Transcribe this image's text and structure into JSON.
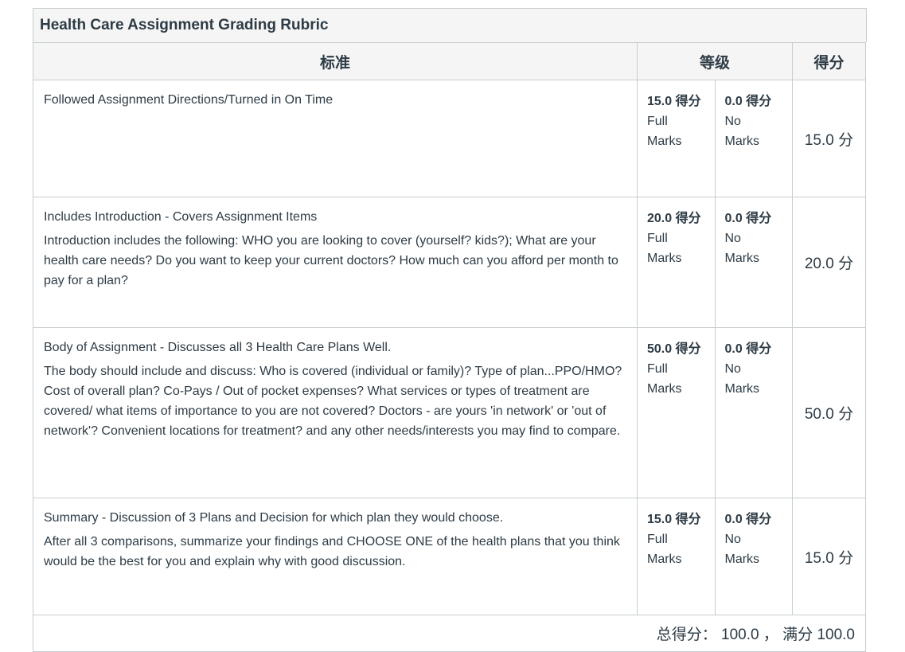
{
  "rubric": {
    "title": "Health Care Assignment Grading Rubric",
    "headers": {
      "criteria": "标准",
      "ratings": "等级",
      "points": "得分"
    },
    "criteria": [
      {
        "description": "Followed Assignment Directions/Turned in On Time",
        "long_description": "",
        "ratings": [
          {
            "points": "15.0 得分",
            "label_line1": "Full",
            "label_line2": "Marks"
          },
          {
            "points": "0.0 得分",
            "label_line1": "No",
            "label_line2": "Marks"
          }
        ],
        "score": "15.0 分"
      },
      {
        "description": "Includes Introduction - Covers Assignment Items",
        "long_description": "Introduction includes the following: WHO you are looking to cover (yourself? kids?); What are your health care needs? Do you want to keep your current doctors? How much can you afford per month to pay for a plan?",
        "ratings": [
          {
            "points": "20.0 得分",
            "label_line1": "Full",
            "label_line2": "Marks"
          },
          {
            "points": "0.0 得分",
            "label_line1": "No",
            "label_line2": "Marks"
          }
        ],
        "score": "20.0 分"
      },
      {
        "description": "Body of Assignment - Discusses all 3 Health Care Plans Well.",
        "long_description": "The body should include and discuss: Who is covered (individual or family)? Type of plan...PPO/HMO? Cost of overall plan? Co-Pays / Out of pocket expenses? What services or types of treatment are covered/ what items of importance to you are not covered? Doctors - are yours 'in network' or 'out of network'? Convenient locations for treatment? and any other needs/interests you may find to compare.",
        "ratings": [
          {
            "points": "50.0 得分",
            "label_line1": "Full",
            "label_line2": "Marks"
          },
          {
            "points": "0.0 得分",
            "label_line1": "No",
            "label_line2": "Marks"
          }
        ],
        "score": "50.0 分"
      },
      {
        "description": "Summary - Discussion of 3 Plans and Decision for which plan they would choose.",
        "long_description": "After all 3 comparisons, summarize your findings and CHOOSE ONE of the health plans that you think would be the best for you and explain why with good discussion.",
        "ratings": [
          {
            "points": "15.0 得分",
            "label_line1": "Full",
            "label_line2": "Marks"
          },
          {
            "points": "0.0 得分",
            "label_line1": "No",
            "label_line2": "Marks"
          }
        ],
        "score": "15.0 分"
      }
    ],
    "footer": {
      "total_label": "总得分：",
      "total_value": "100.0",
      "separator": "，",
      "max_label": "满分",
      "max_value": "100.0"
    }
  }
}
